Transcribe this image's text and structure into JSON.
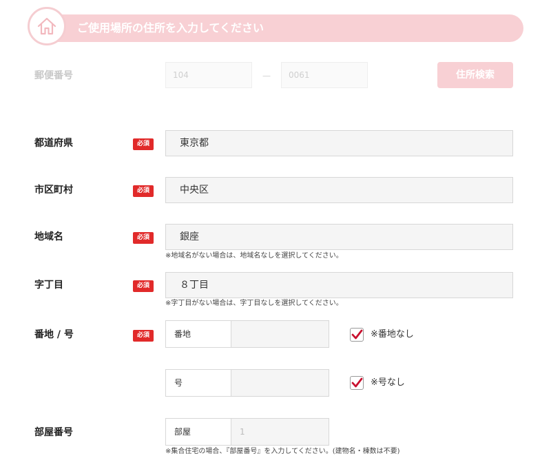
{
  "header": {
    "title": "ご使用場所の住所を入力してください",
    "icon": "home-icon",
    "color": "#f8d0d4"
  },
  "postal": {
    "label": "郵便番号",
    "part1": "104",
    "separator": "—",
    "part2": "0061",
    "search_button": "住所検索"
  },
  "required_badge": "必須",
  "prefecture": {
    "label": "都道府県",
    "value": "東京都"
  },
  "city": {
    "label": "市区町村",
    "value": "中央区"
  },
  "area": {
    "label": "地域名",
    "value": "銀座",
    "note": "※地域名がない場合は、地域名なしを選択してください。"
  },
  "chome": {
    "label": "字丁目",
    "value": "８丁目",
    "note": "※字丁目がない場合は、字丁目なしを選択してください。"
  },
  "banchi": {
    "label": "番地 / 号",
    "banchi_label": "番地",
    "banchi_value": "",
    "banchi_none": "※番地なし",
    "go_label": "号",
    "go_value": "",
    "go_none": "※号なし"
  },
  "room": {
    "label": "部屋番号",
    "sub_label": "部屋",
    "placeholder": "1",
    "note": "※集合住宅の場合、『部屋番号』を入力してください。(建物名・棟数は不要)"
  },
  "colors": {
    "badge": "#e12a2a",
    "check": "#c8102e"
  }
}
